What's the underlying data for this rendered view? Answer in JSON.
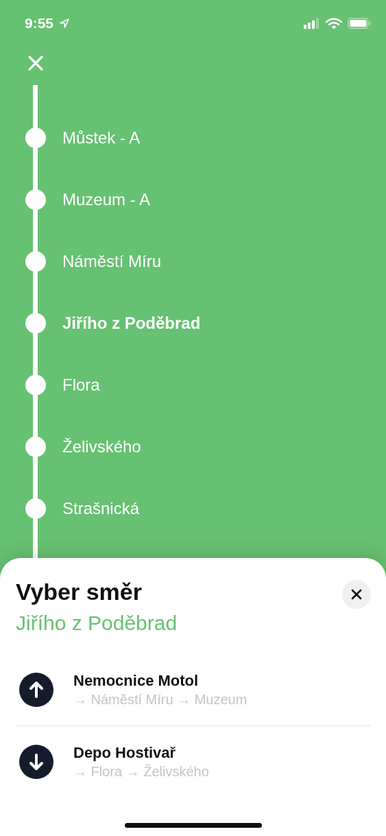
{
  "status_bar": {
    "time": "9:55"
  },
  "stops": [
    {
      "name": "Můstek - A",
      "selected": false
    },
    {
      "name": "Muzeum - A",
      "selected": false
    },
    {
      "name": "Náměstí Míru",
      "selected": false
    },
    {
      "name": "Jiřího z Poděbrad",
      "selected": true
    },
    {
      "name": "Flora",
      "selected": false
    },
    {
      "name": "Želivského",
      "selected": false
    },
    {
      "name": "Strašnická",
      "selected": false
    }
  ],
  "sheet": {
    "title": "Vyber směr",
    "subtitle": "Jiřího z Poděbrad",
    "directions": [
      {
        "kind": "up",
        "destination": "Nemocnice Motol",
        "via": "→ Náměstí Míru → Muzeum"
      },
      {
        "kind": "down",
        "destination": "Depo Hostivař",
        "via": "→ Flora → Želivského"
      }
    ]
  }
}
